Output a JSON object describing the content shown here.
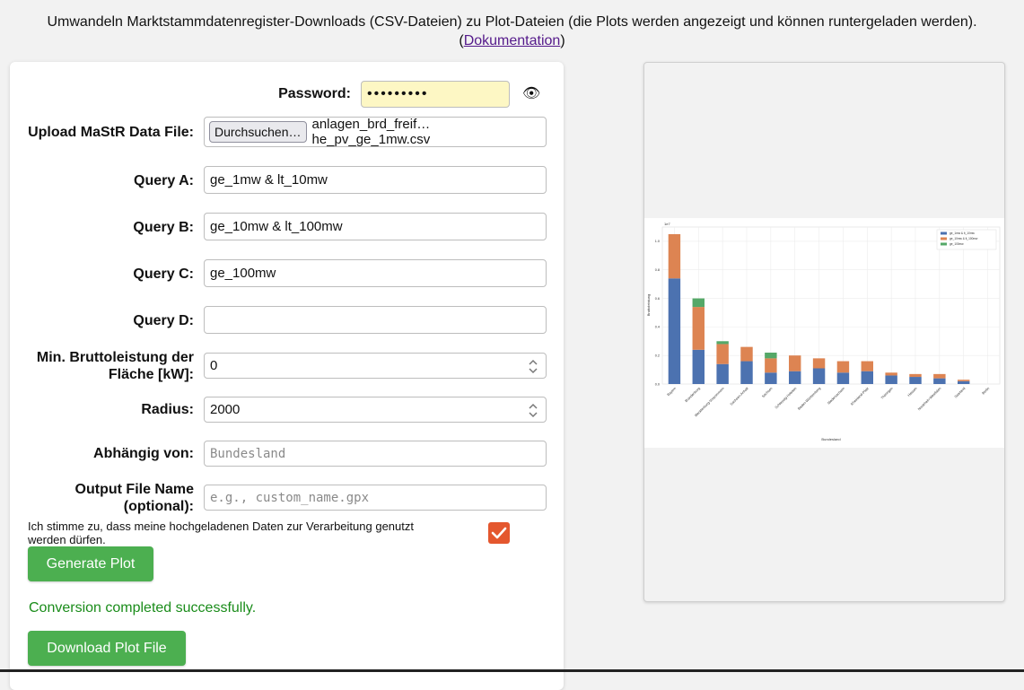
{
  "header": {
    "description": "Umwandeln Marktstammdatenregister-Downloads (CSV-Dateien) zu Plot-Dateien (die Plots werden angezeigt und können runtergeladen werden).",
    "doc_open": "(",
    "doc_link": "Dokumentation",
    "doc_close": ")"
  },
  "form": {
    "password_label": "Password:",
    "password_value": "•••••••••",
    "upload_label": "Upload MaStR Data File:",
    "browse_label": "Durchsuchen…",
    "file_name": "anlagen_brd_freif…he_pv_ge_1mw.csv",
    "query_a_label": "Query A:",
    "query_a_value": "ge_1mw & lt_10mw",
    "query_b_label": "Query B:",
    "query_b_value": "ge_10mw & lt_100mw",
    "query_c_label": "Query C:",
    "query_c_value": "ge_100mw",
    "query_d_label": "Query D:",
    "query_d_value": "",
    "min_label_1": "Min. Bruttoleistung der",
    "min_label_2": "Fläche [kW]:",
    "min_value": "0",
    "radius_label": "Radius:",
    "radius_value": "2000",
    "depends_label": "Abhängig von:",
    "depends_placeholder": "Bundesland",
    "output_label_1": "Output File Name",
    "output_label_2": "(optional):",
    "output_placeholder": "e.g., custom_name.gpx",
    "consent_text": "Ich stimme zu, dass meine hochgeladenen Daten zur Verarbeitung genutzt werden dürfen.",
    "consent_checked": true,
    "generate_label": "Generate Plot",
    "status_text": "Conversion completed successfully.",
    "download_label": "Download Plot File"
  },
  "colors": {
    "button_green": "#4caf50",
    "status_green": "#1a8c1a",
    "checkbox": "#e4572e",
    "series_a": "#4c72b0",
    "series_b": "#dd8452",
    "series_c": "#55a868"
  },
  "chart_data": {
    "type": "bar",
    "stacked": true,
    "scale_label": "1e7",
    "xlabel": "Bundesland",
    "ylabel": "Bruttoleistung",
    "ylim": [
      0,
      1.1
    ],
    "yticks": [
      "0.0",
      "0.2",
      "0.4",
      "0.6",
      "0.8",
      "1.0"
    ],
    "legend_position": "top-right",
    "grid": true,
    "categories": [
      "Bayern",
      "Brandenburg",
      "Mecklenburg-Vorpommern",
      "Sachsen-Anhalt",
      "Sachsen",
      "Schleswig-Holstein",
      "Baden-Württemberg",
      "Niedersachsen",
      "Rheinland-Pfalz",
      "Thüringen",
      "Hessen",
      "Nordrhein-Westfalen",
      "Saarland",
      "Berlin"
    ],
    "series": [
      {
        "name": "ge_1mw & lt_10mw",
        "values": [
          0.74,
          0.24,
          0.14,
          0.16,
          0.08,
          0.09,
          0.11,
          0.08,
          0.09,
          0.06,
          0.05,
          0.04,
          0.02,
          0.0
        ]
      },
      {
        "name": "ge_10mw & lt_100mw",
        "values": [
          0.31,
          0.3,
          0.14,
          0.1,
          0.1,
          0.11,
          0.07,
          0.08,
          0.07,
          0.02,
          0.02,
          0.03,
          0.01,
          0.0
        ]
      },
      {
        "name": "ge_100mw",
        "values": [
          0.0,
          0.06,
          0.02,
          0.0,
          0.04,
          0.0,
          0.0,
          0.0,
          0.0,
          0.0,
          0.0,
          0.0,
          0.0,
          0.0
        ]
      }
    ]
  }
}
